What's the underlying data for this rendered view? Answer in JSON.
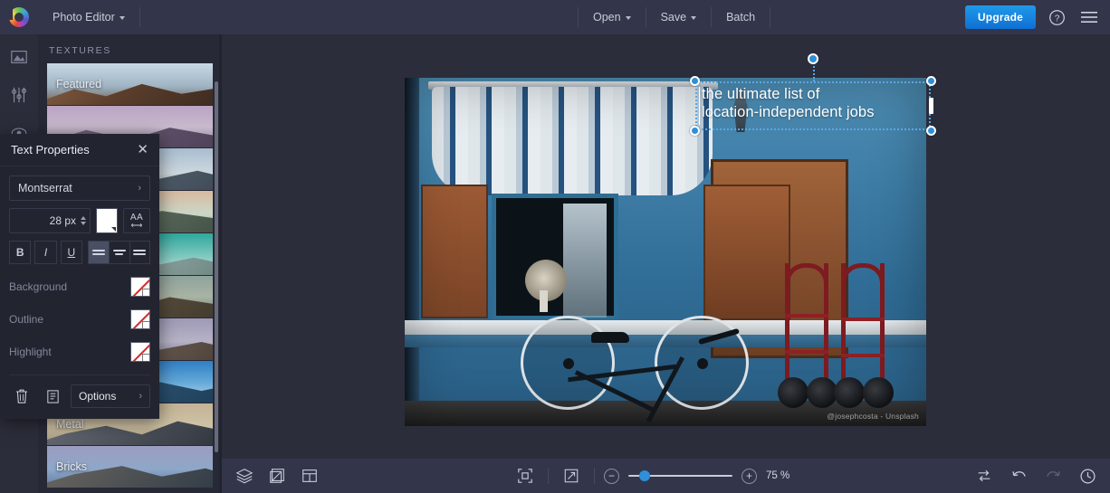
{
  "app": {
    "logo_icon": "color-wheel-logo",
    "title": "Photo Editor",
    "menus": [
      {
        "label": "Open",
        "has_caret": true
      },
      {
        "label": "Save",
        "has_caret": true
      },
      {
        "label": "Batch",
        "has_caret": false
      }
    ],
    "upgrade_label": "Upgrade",
    "help_icon": "question-mark-icon",
    "menu_icon": "hamburger-menu-icon"
  },
  "rail": {
    "items": [
      {
        "icon": "image-icon",
        "name": "image-tool"
      },
      {
        "icon": "adjust-sliders-icon",
        "name": "adjust-tool"
      },
      {
        "icon": "effects-eye-icon",
        "name": "effects-tool"
      }
    ]
  },
  "textures": {
    "header": "TEXTURES",
    "items": [
      {
        "label": "Featured"
      },
      {
        "label": ""
      },
      {
        "label": ""
      },
      {
        "label": ""
      },
      {
        "label": ""
      },
      {
        "label": ""
      },
      {
        "label": ""
      },
      {
        "label": ""
      },
      {
        "label": "Metal"
      },
      {
        "label": "Bricks"
      }
    ]
  },
  "text_properties": {
    "title": "Text Properties",
    "close_icon": "close-icon",
    "font": {
      "value": "Montserrat",
      "chevron": "›"
    },
    "size": {
      "value": "28 px",
      "placeholder": "28 px"
    },
    "color_swatch": "#ffffff",
    "spacing_icon": {
      "glyph": "AA",
      "arrow": "⟷"
    },
    "style_buttons": [
      {
        "label": "B",
        "name": "bold-button",
        "active": false
      },
      {
        "label": "I",
        "name": "italic-button",
        "active": false
      },
      {
        "label": "U",
        "name": "underline-button",
        "active": false
      }
    ],
    "align_buttons": [
      {
        "name": "align-left-button",
        "active": true
      },
      {
        "name": "align-center-button",
        "active": false
      },
      {
        "name": "align-right-button",
        "active": false
      }
    ],
    "swatch_rows": [
      {
        "label": "Background",
        "value": "none"
      },
      {
        "label": "Outline",
        "value": "none"
      },
      {
        "label": "Highlight",
        "value": "none"
      }
    ],
    "footer": {
      "delete_icon": "trash-icon",
      "duplicate_icon": "duplicate-layer-icon",
      "options_label": "Options",
      "options_chevron": "›"
    }
  },
  "canvas": {
    "overlay_text": "the ultimate list of\nlocation-independent jobs",
    "watermark": "@josephcosta - Unsplash",
    "selection": {
      "handles": [
        "top-left",
        "top-right",
        "bottom-left",
        "bottom-right",
        "rotate"
      ]
    }
  },
  "bottom_bar": {
    "left_icons": [
      {
        "icon": "layers-icon",
        "name": "layers-button"
      },
      {
        "icon": "crop-resize-icon",
        "name": "resize-button"
      },
      {
        "icon": "layout-icon",
        "name": "layout-button"
      }
    ],
    "center_icons": [
      {
        "icon": "fit-to-screen-icon",
        "name": "fit-screen-button"
      },
      {
        "icon": "fullscreen-expand-icon",
        "name": "expand-button"
      }
    ],
    "zoom": {
      "minus_label": "−",
      "plus_label": "+",
      "value": "75 %",
      "percent": 75,
      "knob_position_pct": 11
    },
    "right_icons": [
      {
        "icon": "compare-swap-icon",
        "name": "compare-button",
        "dim": false
      },
      {
        "icon": "undo-arrow-icon",
        "name": "undo-button",
        "dim": false
      },
      {
        "icon": "redo-arrow-icon",
        "name": "redo-button",
        "dim": true
      },
      {
        "icon": "history-clock-icon",
        "name": "history-button",
        "dim": false
      }
    ]
  },
  "colors": {
    "accent_blue": "#2f8fd8",
    "topbar_bg": "#33354a",
    "panel_bg": "#22242f",
    "canvas_bg": "#2b2d3a",
    "none_slash": "#d32b2b"
  }
}
